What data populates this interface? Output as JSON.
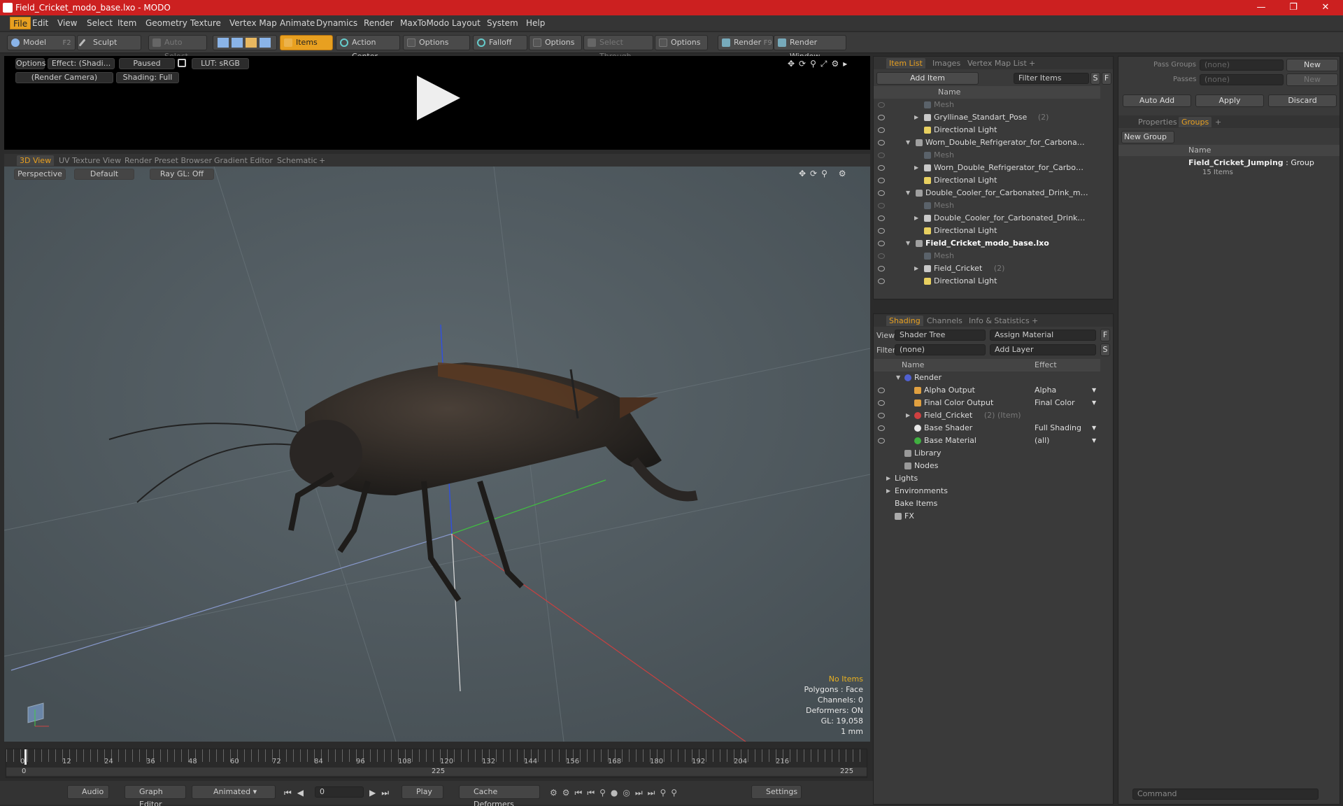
{
  "window": {
    "title": "Field_Cricket_modo_base.lxo - MODO",
    "min": "—",
    "restore": "❐",
    "close": "✕"
  },
  "menu": [
    "File",
    "Edit",
    "View",
    "Select",
    "Item",
    "Geometry",
    "Texture",
    "Vertex Map",
    "Animate",
    "Dynamics",
    "Render",
    "MaxToModo",
    "Layout",
    "System",
    "Help"
  ],
  "toolbar": {
    "model": "Model",
    "model_key": "F2",
    "sculpt": "Sculpt",
    "auto_select": "Auto Select",
    "items": "Items",
    "action_center": "Action Center",
    "options1": "Options",
    "falloff": "Falloff",
    "options2": "Options",
    "select_through": "Select Through",
    "options3": "Options",
    "render": "Render",
    "render_key": "F9",
    "render_window": "Render Window"
  },
  "render_pane": {
    "options": "Options",
    "effect": "Effect: (Shadi...",
    "paused": "Paused",
    "lut": "LUT: sRGB",
    "camera": "(Render Camera)",
    "shading": "Shading: Full"
  },
  "view_tabs": [
    "3D View",
    "UV Texture View",
    "Render Preset Browser",
    "Gradient Editor",
    "Schematic",
    "+"
  ],
  "viewport": {
    "perspective": "Perspective",
    "default": "Default",
    "raygl": "Ray GL: Off",
    "hud": [
      "No Items",
      "Polygons : Face",
      "Channels: 0",
      "Deformers: ON",
      "GL: 19,058",
      "1 mm"
    ]
  },
  "timeline": {
    "ticks": [
      "0",
      "12",
      "24",
      "36",
      "48",
      "60",
      "72",
      "84",
      "96",
      "108",
      "120",
      "132",
      "144",
      "156",
      "168",
      "180",
      "192",
      "204",
      "216"
    ],
    "start": "0",
    "mid": "225",
    "end": "225"
  },
  "bottom": {
    "audio": "Audio",
    "graph_editor": "Graph Editor",
    "animated": "Animated",
    "frame": "0",
    "play": "Play",
    "cache": "Cache Deformers",
    "settings": "Settings"
  },
  "item_list": {
    "tabs": [
      "Item List",
      "Images",
      "Vertex Map List",
      "+"
    ],
    "add_item": "Add Item",
    "filter": "Filter Items",
    "s": "S",
    "f": "F",
    "col_name": "Name",
    "rows": [
      {
        "label": "Mesh",
        "indent": 3,
        "dim": true,
        "icon": "mesh"
      },
      {
        "label": "Gryllinae_Standart_Pose",
        "count": "(2)",
        "indent": 3,
        "arrow": "▶",
        "icon": "group"
      },
      {
        "label": "Directional Light",
        "indent": 3,
        "icon": "light"
      },
      {
        "label": "Worn_Double_Refrigerator_for_Carbona…",
        "indent": 2,
        "arrow": "▼",
        "icon": "scene"
      },
      {
        "label": "Mesh",
        "indent": 3,
        "dim": true,
        "icon": "mesh"
      },
      {
        "label": "Worn_Double_Refrigerator_for_Carbo…",
        "indent": 3,
        "arrow": "▶",
        "icon": "group"
      },
      {
        "label": "Directional Light",
        "indent": 3,
        "icon": "light"
      },
      {
        "label": "Double_Cooler_for_Carbonated_Drink_m…",
        "indent": 2,
        "arrow": "▼",
        "icon": "scene"
      },
      {
        "label": "Mesh",
        "indent": 3,
        "dim": true,
        "icon": "mesh"
      },
      {
        "label": "Double_Cooler_for_Carbonated_Drink…",
        "indent": 3,
        "arrow": "▶",
        "icon": "group"
      },
      {
        "label": "Directional Light",
        "indent": 3,
        "icon": "light"
      },
      {
        "label": "Field_Cricket_modo_base.lxo",
        "indent": 2,
        "arrow": "▼",
        "icon": "scene",
        "bold": true
      },
      {
        "label": "Mesh",
        "indent": 3,
        "dim": true,
        "icon": "mesh"
      },
      {
        "label": "Field_Cricket",
        "count": "(2)",
        "indent": 3,
        "arrow": "▶",
        "icon": "group"
      },
      {
        "label": "Directional Light",
        "indent": 3,
        "icon": "light"
      }
    ]
  },
  "shading": {
    "tabs": [
      "Shading",
      "Channels",
      "Info & Statistics",
      "+"
    ],
    "view_label": "View",
    "view_value": "Shader Tree",
    "assign": "Assign Material",
    "f": "F",
    "filter_label": "Filter",
    "filter_value": "(none)",
    "add_layer": "Add Layer",
    "s": "S",
    "col_name": "Name",
    "col_effect": "Effect",
    "rows": [
      {
        "label": "Render",
        "effect": "",
        "indent": 1,
        "arrow": "▼",
        "icon": "render",
        "eye": false
      },
      {
        "label": "Alpha Output",
        "effect": "Alpha",
        "indent": 2,
        "icon": "output",
        "eye": true
      },
      {
        "label": "Final Color Output",
        "effect": "Final Color",
        "indent": 2,
        "icon": "output",
        "eye": true
      },
      {
        "label": "Field_Cricket",
        "count": "(2) (Item)",
        "effect": "",
        "indent": 2,
        "arrow": "▶",
        "icon": "material",
        "eye": true
      },
      {
        "label": "Base Shader",
        "effect": "Full Shading",
        "indent": 2,
        "icon": "shader",
        "eye": true
      },
      {
        "label": "Base Material",
        "effect": "(all)",
        "indent": 2,
        "icon": "basemat",
        "eye": true
      },
      {
        "label": "Library",
        "effect": "",
        "indent": 1,
        "icon": "folder",
        "eye": false
      },
      {
        "label": "Nodes",
        "effect": "",
        "indent": 1,
        "icon": "folder",
        "eye": false
      },
      {
        "label": "Lights",
        "effect": "",
        "indent": 0,
        "arrow": "▶",
        "icon": "none",
        "eye": false
      },
      {
        "label": "Environments",
        "effect": "",
        "indent": 0,
        "arrow": "▶",
        "icon": "none",
        "eye": false
      },
      {
        "label": "Bake Items",
        "effect": "",
        "indent": 0,
        "icon": "none",
        "eye": false
      },
      {
        "label": "FX",
        "effect": "",
        "indent": 0,
        "icon": "fx",
        "eye": false
      }
    ]
  },
  "groups": {
    "pass_groups": "Pass Groups",
    "passes": "Passes",
    "none1": "(none)",
    "none2": "(none)",
    "new1": "New",
    "new2": "New",
    "auto_add": "Auto Add",
    "apply": "Apply",
    "discard": "Discard",
    "tabs": [
      "Properties",
      "Groups",
      "+"
    ],
    "new_group": "New Group",
    "col_name": "Name",
    "group_name": "Field_Cricket_Jumping",
    "group_type": ": Group",
    "group_count": "15 Items",
    "command": "Command"
  },
  "colors": {
    "accent": "#e8a020",
    "title": "#cc2020",
    "viewport": "#515b60"
  }
}
